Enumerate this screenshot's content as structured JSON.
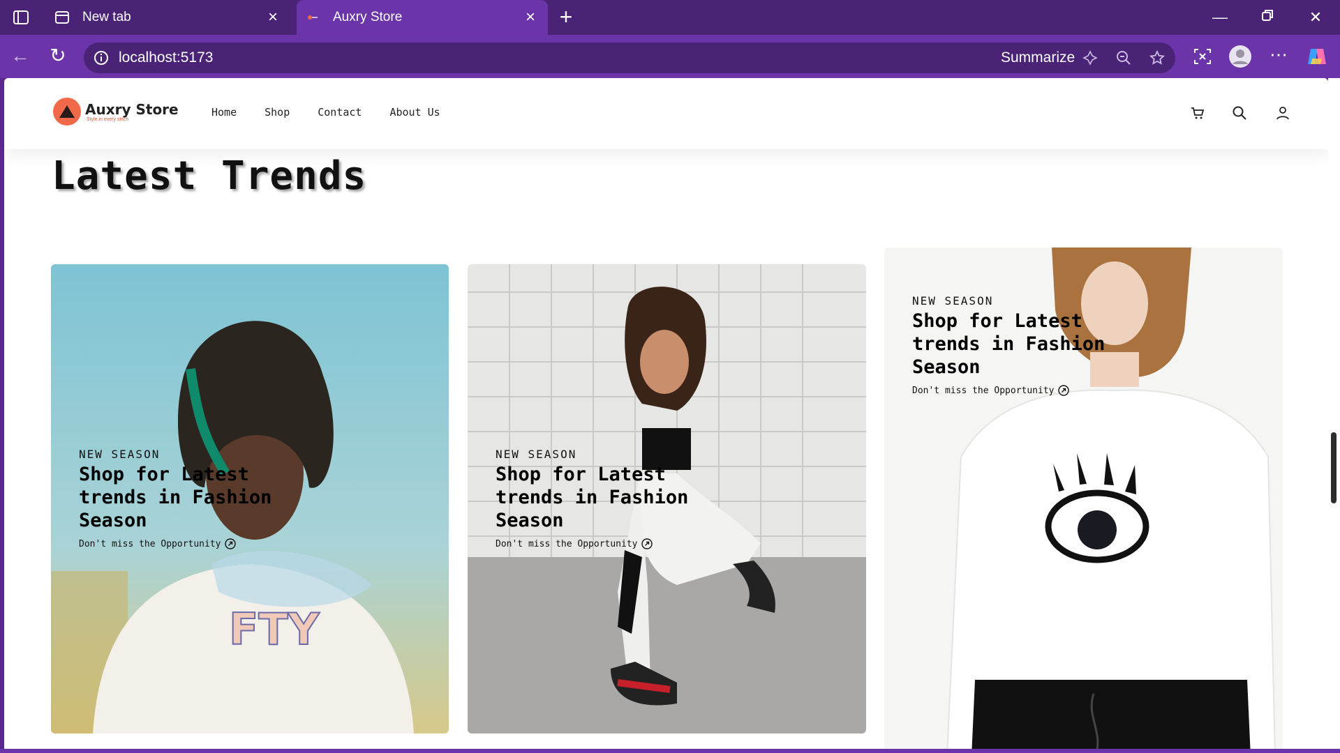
{
  "browser": {
    "tabs": [
      {
        "label": "New tab",
        "active": false
      },
      {
        "label": "Auxry Store",
        "active": true
      }
    ],
    "url": "localhost:5173",
    "summarize_label": "Summarize"
  },
  "site": {
    "brand": "Auxry Store",
    "tagline": "Style in every stitch",
    "brand_color": "#f06a4a",
    "nav": [
      "Home",
      "Shop",
      "Contact",
      "About Us"
    ]
  },
  "section": {
    "title": "Latest Trends"
  },
  "cards": [
    {
      "eyebrow": "NEW SEASON",
      "headline": "Shop for Latest trends in Fashion Season",
      "cta": "Don't miss the Opportunity",
      "image": "man-in-white-tshirt-photo"
    },
    {
      "eyebrow": "NEW SEASON",
      "headline": "Shop for Latest trends in Fashion Season",
      "cta": "Don't miss the Opportunity",
      "image": "woman-crouching-photo"
    },
    {
      "eyebrow": "NEW SEASON",
      "headline": "Shop for Latest trends in Fashion Season",
      "cta": "Don't miss the Opportunity",
      "image": "woman-eye-tshirt-photo"
    }
  ]
}
